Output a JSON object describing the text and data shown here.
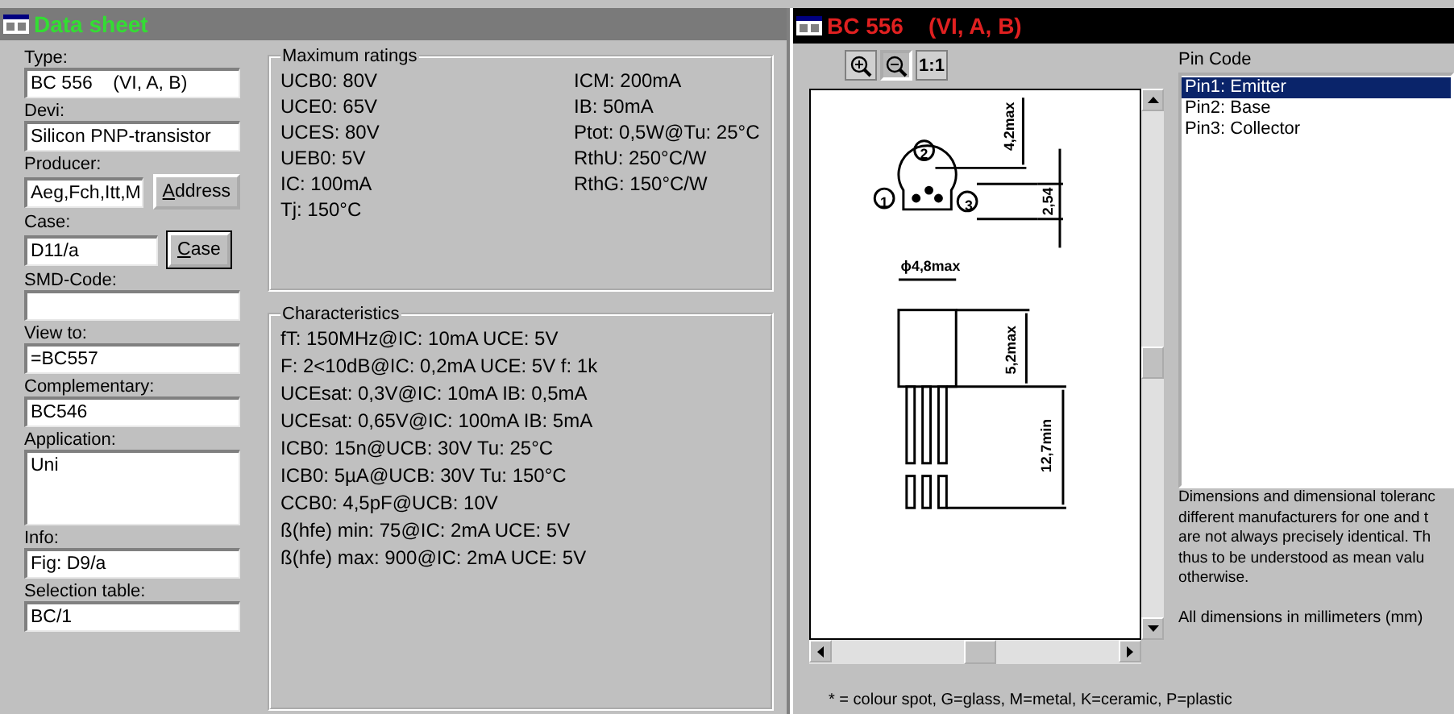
{
  "data_sheet": {
    "title": "Data sheet",
    "fields": [
      {
        "label": "Type:",
        "value": "BC 556    (VI, A, B)",
        "kind": "single"
      },
      {
        "label": "Devi:",
        "value": "Silicon PNP-transistor",
        "kind": "single"
      },
      {
        "label": "Producer:",
        "value": "Aeg,Fch,Itt,M",
        "kind": "single",
        "button": {
          "label": "Address",
          "default": false
        }
      },
      {
        "label": "Case:",
        "value": "D11/a",
        "kind": "single",
        "button": {
          "label": "Case",
          "default": true
        }
      },
      {
        "label": "SMD-Code:",
        "kind": "single"
      },
      {
        "label": "View to:",
        "value": "=BC557",
        "kind": "single"
      },
      {
        "label": "Complementary:",
        "value": "BC546",
        "kind": "single"
      },
      {
        "label": "Application:",
        "value": "Uni",
        "kind": "multiline"
      },
      {
        "label": "Info:",
        "value": "Fig: D9/a",
        "kind": "single"
      },
      {
        "label": "Selection table:",
        "value": "BC/1",
        "kind": "single"
      }
    ],
    "maximum_ratings": {
      "title": "Maximum ratings",
      "column_1": [
        "UCB0: 80V",
        "UCE0: 65V",
        "UCES: 80V",
        "UEB0: 5V",
        "IC: 100mA",
        "Tj: 150°C"
      ],
      "column_2": [
        "ICM: 200mA",
        "IB: 50mA",
        "Ptot: 0,5W@Tu: 25°C",
        "RthU: 250°C/W",
        "RthG: 150°C/W"
      ]
    },
    "characteristics": {
      "title": "Characteristics",
      "lines": [
        "fT: 150MHz@IC: 10mA UCE: 5V",
        "F: 2<10dB@IC: 0,2mA UCE: 5V f: 1k",
        "UCEsat: 0,3V@IC: 10mA IB: 0,5mA",
        "UCEsat: 0,65V@IC: 100mA IB: 5mA",
        "ICB0: 15n@UCB: 30V Tu: 25°C",
        "ICB0: 5µA@UCB: 30V Tu: 150°C",
        "CCB0: 4,5pF@UCB: 10V",
        "ß(hfe) min: 75@IC: 2mA UCE: 5V",
        "ß(hfe) max: 900@IC: 2mA UCE: 5V"
      ]
    }
  },
  "case_window": {
    "title": "BC 556    (VI, A, B)",
    "toolbar": [
      {
        "kind": "zoom-in",
        "pressed": false
      },
      {
        "kind": "zoom-out",
        "pressed": true
      },
      {
        "kind": "text",
        "label": "1:1",
        "pressed": false
      }
    ],
    "drawing_labels": [
      "1",
      "2",
      "3",
      "4,2max",
      "2,54",
      "ϕ4,8max",
      "5,2max",
      "12,7min"
    ],
    "pin_code": {
      "title": "Pin Code",
      "items": [
        {
          "label": "Pin1: Emitter",
          "selected": true
        },
        {
          "label": "Pin2: Base",
          "selected": false
        },
        {
          "label": "Pin3: Collector",
          "selected": false
        }
      ]
    },
    "note_lines": [
      "Dimensions and dimensional toleranc",
      "different manufacturers for one and t",
      "are not always precisely identical. Th",
      "thus to be understood as mean valu",
      "otherwise."
    ],
    "units_note": "All dimensions in millimeters (mm)",
    "legend": "* = colour spot, G=glass, M=metal, K=ceramic, P=plastic"
  }
}
